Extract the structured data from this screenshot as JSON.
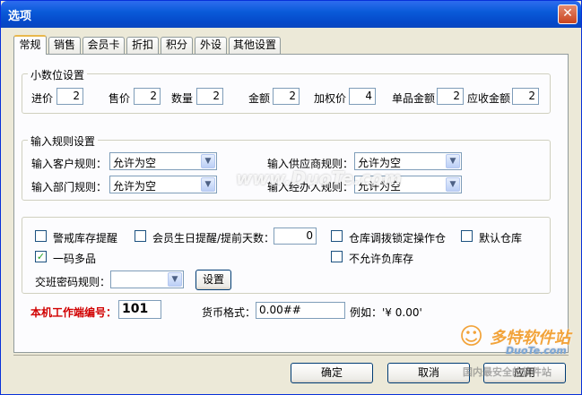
{
  "window": {
    "title": "选项",
    "close_glyph": "✕"
  },
  "tabs": [
    {
      "label": "常规"
    },
    {
      "label": "销售"
    },
    {
      "label": "会员卡"
    },
    {
      "label": "折扣"
    },
    {
      "label": "积分"
    },
    {
      "label": "外设"
    },
    {
      "label": "其他设置"
    }
  ],
  "decimal": {
    "legend": "小数位设置",
    "fields": [
      {
        "label": "进价",
        "value": "2"
      },
      {
        "label": "售价",
        "value": "2"
      },
      {
        "label": "数量",
        "value": "2"
      },
      {
        "label": "金额",
        "value": "2"
      },
      {
        "label": "加权价",
        "value": "4"
      },
      {
        "label": "单品金额",
        "value": "2"
      },
      {
        "label": "应收金额",
        "value": "2"
      }
    ]
  },
  "rules": {
    "legend": "输入规则设置",
    "customer": {
      "label": "输入客户规则：",
      "value": "允许为空"
    },
    "supplier": {
      "label": "输入供应商规则：",
      "value": "允许为空"
    },
    "department": {
      "label": "输入部门规则：",
      "value": "允许为空"
    },
    "handler": {
      "label": "输入经办人规则：",
      "value": "允许为空"
    }
  },
  "options": {
    "stock_alert": {
      "label": "警戒库存提醒",
      "checked": false
    },
    "birthday": {
      "label": "会员生日提醒/提前天数：",
      "checked": false,
      "days": "0"
    },
    "lock_transfer": {
      "label": "仓库调拨锁定操作仓",
      "checked": false
    },
    "default_warehouse": {
      "label": "默认仓库",
      "checked": false
    },
    "multi_code": {
      "label": "一码多品",
      "checked": true,
      "mark": "✓"
    },
    "no_negative": {
      "label": "不允许负库存",
      "checked": false
    },
    "shift_password": {
      "label": "交班密码规则：",
      "value": ""
    },
    "settings_button": "设置"
  },
  "terminal": {
    "label": "本机工作端编号：",
    "value": "101",
    "label_color": "#d10000"
  },
  "currency": {
    "label": "货币格式：",
    "value": "0.00##",
    "example": "例如：'¥ 0.00'"
  },
  "footer": {
    "ok": "确定",
    "cancel": "取消",
    "apply": "应用"
  },
  "watermarks": {
    "top": "www.DuoTe.com",
    "brand": "多特软件站",
    "brand_url": "DuoTe.com",
    "tagline": "国内最安全的软件站"
  },
  "colors": {
    "titlebar": "#0a5bd9",
    "accent_tab": "#e9b84c"
  }
}
